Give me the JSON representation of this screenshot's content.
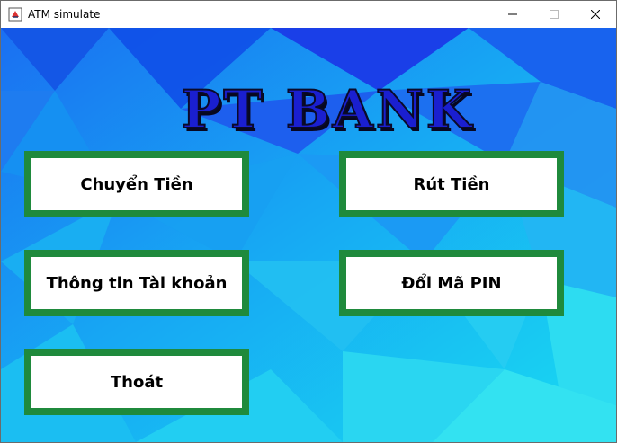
{
  "window": {
    "title": "ATM simulate",
    "icon": "java-cup-icon",
    "controls": [
      "minimize-icon",
      "maximize-icon",
      "close-icon"
    ]
  },
  "header": {
    "bank_name": "PT BANK"
  },
  "menu": {
    "transfer_label": "Chuyển Tiền",
    "withdraw_label": "Rút Tiền",
    "account_info_label": "Thông tin Tài khoản",
    "change_pin_label": "Đổi Mã PIN",
    "exit_label": "Thoát"
  },
  "colors": {
    "button_border": "#1f8a3c",
    "background_primary": "#0a6cf0",
    "background_secondary": "#12c8f2",
    "title_fill": "#1a1fd0"
  }
}
